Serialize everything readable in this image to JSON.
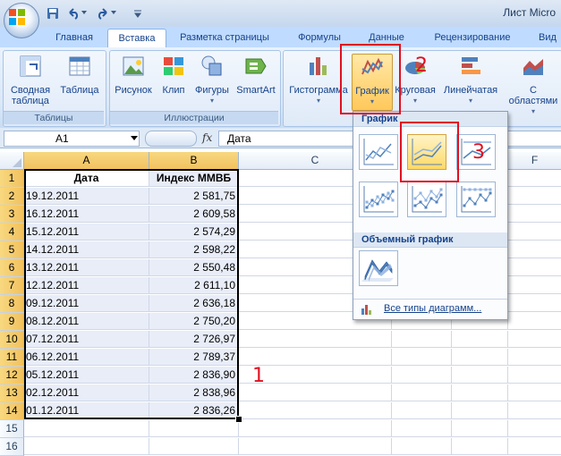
{
  "window": {
    "title": "Лист Micro"
  },
  "tabs": [
    "Главная",
    "Вставка",
    "Разметка страницы",
    "Формулы",
    "Данные",
    "Рецензирование",
    "Вид"
  ],
  "ribbon": {
    "tables_group": {
      "label": "Таблицы",
      "pivot_line1": "Сводная",
      "pivot_line2": "таблица",
      "table": "Таблица"
    },
    "illustrations_group": {
      "label": "Иллюстрации",
      "picture": "Рисунок",
      "clip": "Клип",
      "shapes": "Фигуры",
      "smartart": "SmartArt"
    },
    "charts": {
      "histogram": "Гистограмма",
      "line": "График",
      "pie": "Круговая",
      "bar": "Линейчатая",
      "area_line1": "С",
      "area_line2": "областями"
    }
  },
  "formula_bar": {
    "cell_ref": "A1",
    "fx": "fx",
    "value": "Дата"
  },
  "columns": [
    "A",
    "B",
    "C",
    "D",
    "E",
    "F"
  ],
  "row_numbers": [
    "1",
    "2",
    "3",
    "4",
    "5",
    "6",
    "7",
    "8",
    "9",
    "10",
    "11",
    "12",
    "13",
    "14",
    "15",
    "16"
  ],
  "table": {
    "headers": [
      "Дата",
      "Индекс ММВБ"
    ],
    "rows": [
      [
        "19.12.2011",
        "2 581,75"
      ],
      [
        "16.12.2011",
        "2 609,58"
      ],
      [
        "15.12.2011",
        "2 574,29"
      ],
      [
        "14.12.2011",
        "2 598,22"
      ],
      [
        "13.12.2011",
        "2 550,48"
      ],
      [
        "12.12.2011",
        "2 611,10"
      ],
      [
        "09.12.2011",
        "2 636,18"
      ],
      [
        "08.12.2011",
        "2 750,20"
      ],
      [
        "07.12.2011",
        "2 726,97"
      ],
      [
        "06.12.2011",
        "2 789,37"
      ],
      [
        "05.12.2011",
        "2 836,90"
      ],
      [
        "02.12.2011",
        "2 838,96"
      ],
      [
        "01.12.2011",
        "2 836,26"
      ]
    ]
  },
  "dropdown": {
    "section_2d": "График",
    "section_3d": "Объемный график",
    "all_types": "Все типы диаграмм..."
  },
  "annotations": {
    "a1": "1",
    "a2": "2",
    "a3": "3"
  },
  "colors": {
    "annotation_red": "#e01020",
    "selection_orange": "#f1c15f",
    "ribbon_blue": "#15428b"
  }
}
